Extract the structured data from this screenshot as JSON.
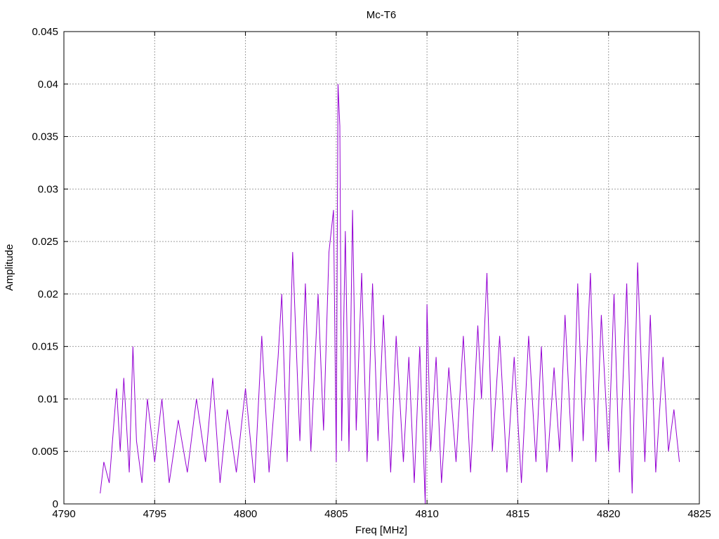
{
  "chart_data": {
    "type": "line",
    "title": "Mc-T6",
    "xlabel": "Freq [MHz]",
    "ylabel": "Amplitude",
    "xlim": [
      4790,
      4825
    ],
    "ylim": [
      0,
      0.045
    ],
    "x_ticks": [
      "4790",
      "4795",
      "4800",
      "4805",
      "4810",
      "4815",
      "4820",
      "4825"
    ],
    "y_ticks": [
      "0",
      "0.005",
      "0.01",
      "0.015",
      "0.02",
      "0.025",
      "0.03",
      "0.035",
      "0.04",
      "0.045"
    ],
    "grid": true,
    "legend": "none",
    "series": [
      {
        "color": "#9400d3",
        "x": [
          4792.0,
          4792.2,
          4792.5,
          4792.9,
          4793.1,
          4793.3,
          4793.6,
          4793.8,
          4794.0,
          4794.3,
          4794.6,
          4795.0,
          4795.4,
          4795.8,
          4796.3,
          4796.8,
          4797.3,
          4797.8,
          4798.2,
          4798.6,
          4799.0,
          4799.5,
          4800.0,
          4800.5,
          4800.9,
          4801.3,
          4801.8,
          4802.0,
          4802.3,
          4802.6,
          4803.0,
          4803.3,
          4803.6,
          4804.0,
          4804.3,
          4804.6,
          4804.85,
          4805.0,
          4805.1,
          4805.2,
          4805.3,
          4805.5,
          4805.7,
          4805.9,
          4806.1,
          4806.4,
          4806.7,
          4807.0,
          4807.3,
          4807.6,
          4808.0,
          4808.3,
          4808.7,
          4809.0,
          4809.3,
          4809.6,
          4809.9,
          4810.0,
          4810.2,
          4810.5,
          4810.8,
          4811.2,
          4811.6,
          4812.0,
          4812.4,
          4812.8,
          4813.0,
          4813.3,
          4813.6,
          4814.0,
          4814.4,
          4814.8,
          4815.2,
          4815.6,
          4816.0,
          4816.3,
          4816.6,
          4817.0,
          4817.3,
          4817.6,
          4818.0,
          4818.3,
          4818.6,
          4819.0,
          4819.3,
          4819.6,
          4820.0,
          4820.3,
          4820.6,
          4821.0,
          4821.3,
          4821.6,
          4822.0,
          4822.3,
          4822.6,
          4823.0,
          4823.3,
          4823.6,
          4823.9
        ],
        "y": [
          0.001,
          0.004,
          0.002,
          0.011,
          0.005,
          0.012,
          0.003,
          0.015,
          0.006,
          0.002,
          0.01,
          0.004,
          0.01,
          0.002,
          0.008,
          0.003,
          0.01,
          0.004,
          0.012,
          0.002,
          0.009,
          0.003,
          0.011,
          0.002,
          0.016,
          0.003,
          0.014,
          0.02,
          0.004,
          0.024,
          0.006,
          0.021,
          0.005,
          0.02,
          0.007,
          0.024,
          0.028,
          0.004,
          0.04,
          0.036,
          0.006,
          0.026,
          0.005,
          0.028,
          0.007,
          0.022,
          0.004,
          0.021,
          0.006,
          0.018,
          0.003,
          0.016,
          0.004,
          0.014,
          0.002,
          0.015,
          0.0,
          0.019,
          0.005,
          0.014,
          0.002,
          0.013,
          0.004,
          0.016,
          0.003,
          0.017,
          0.01,
          0.022,
          0.005,
          0.016,
          0.003,
          0.014,
          0.002,
          0.016,
          0.004,
          0.015,
          0.003,
          0.013,
          0.005,
          0.018,
          0.004,
          0.021,
          0.006,
          0.022,
          0.004,
          0.018,
          0.005,
          0.02,
          0.003,
          0.021,
          0.001,
          0.023,
          0.004,
          0.018,
          0.003,
          0.014,
          0.005,
          0.009,
          0.004
        ]
      }
    ]
  }
}
